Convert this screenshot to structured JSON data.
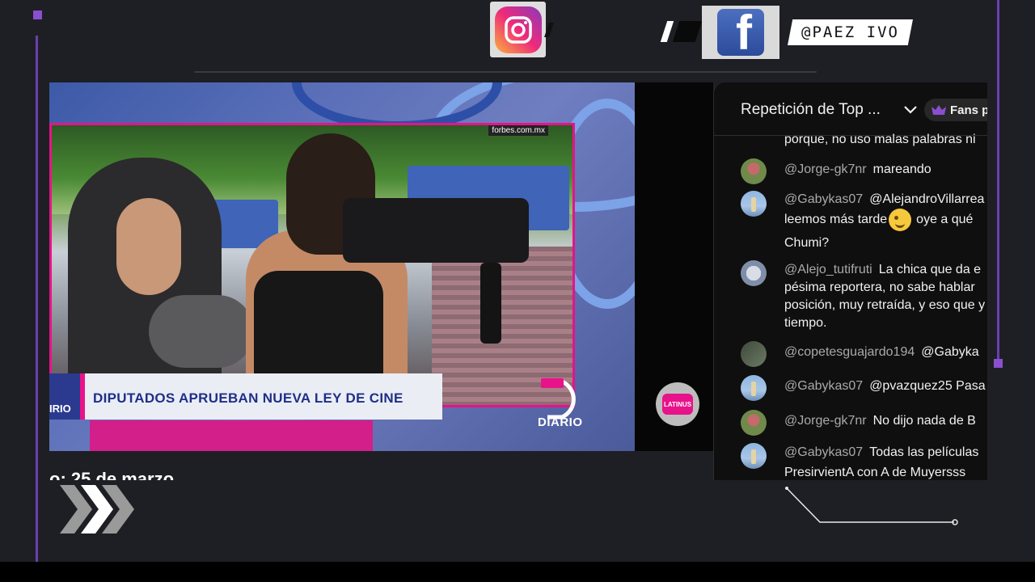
{
  "social": {
    "instagram_icon": "instagram-icon",
    "facebook_icon": "facebook-icon",
    "handle": "@PAEZ IVO"
  },
  "video": {
    "source_tag": "forbes.com.mx",
    "headline": "DIPUTADOS APRUEBAN NUEVA LEY DE CINE",
    "lower_third_left": "IRIO",
    "show_logo": "DIARIO",
    "channel_badge": "LATINUS",
    "date_caption": "o: 25 de marzo"
  },
  "chat": {
    "title": "Repetición de Top ...",
    "fans_button": "Fans p",
    "messages": [
      {
        "author": "",
        "lines": [
          "porque, no uso malas palabras ni"
        ],
        "avatar": "none"
      },
      {
        "author": "@Jorge-gk7nr",
        "lines": [
          "mareando"
        ],
        "avatar": "jorge"
      },
      {
        "author": "@Gabykas07",
        "lines": [
          "@AlejandroVillarrea",
          "leemos más tarde",
          "oye a qué",
          "Chumi?"
        ],
        "avatar": "gaby"
      },
      {
        "author": "@Alejo_tutifruti",
        "lines": [
          "La chica que da e",
          "pésima reportera, no sabe hablar",
          "posición, muy retraída, y eso que y",
          "tiempo."
        ],
        "avatar": "alejo"
      },
      {
        "author": "@copetesguajardo194",
        "lines": [
          "@Gabyka"
        ],
        "avatar": "copetes"
      },
      {
        "author": "@Gabykas07",
        "lines": [
          "@pvazquez25 Pasa"
        ],
        "avatar": "gaby"
      },
      {
        "author": "@Jorge-gk7nr",
        "lines": [
          "No dijo nada de B"
        ],
        "avatar": "jorge"
      },
      {
        "author": "@Gabykas07",
        "lines": [
          "Todas las películas",
          "PresirvientA con A de Muyersss"
        ],
        "avatar": "gaby"
      }
    ]
  },
  "colors": {
    "frame_bg": "#1e1f24",
    "accent_purple": "#8a4fd0",
    "chat_bg": "#0f0f0f",
    "headline_blue": "#1f2f88",
    "magenta": "#e8128a"
  }
}
